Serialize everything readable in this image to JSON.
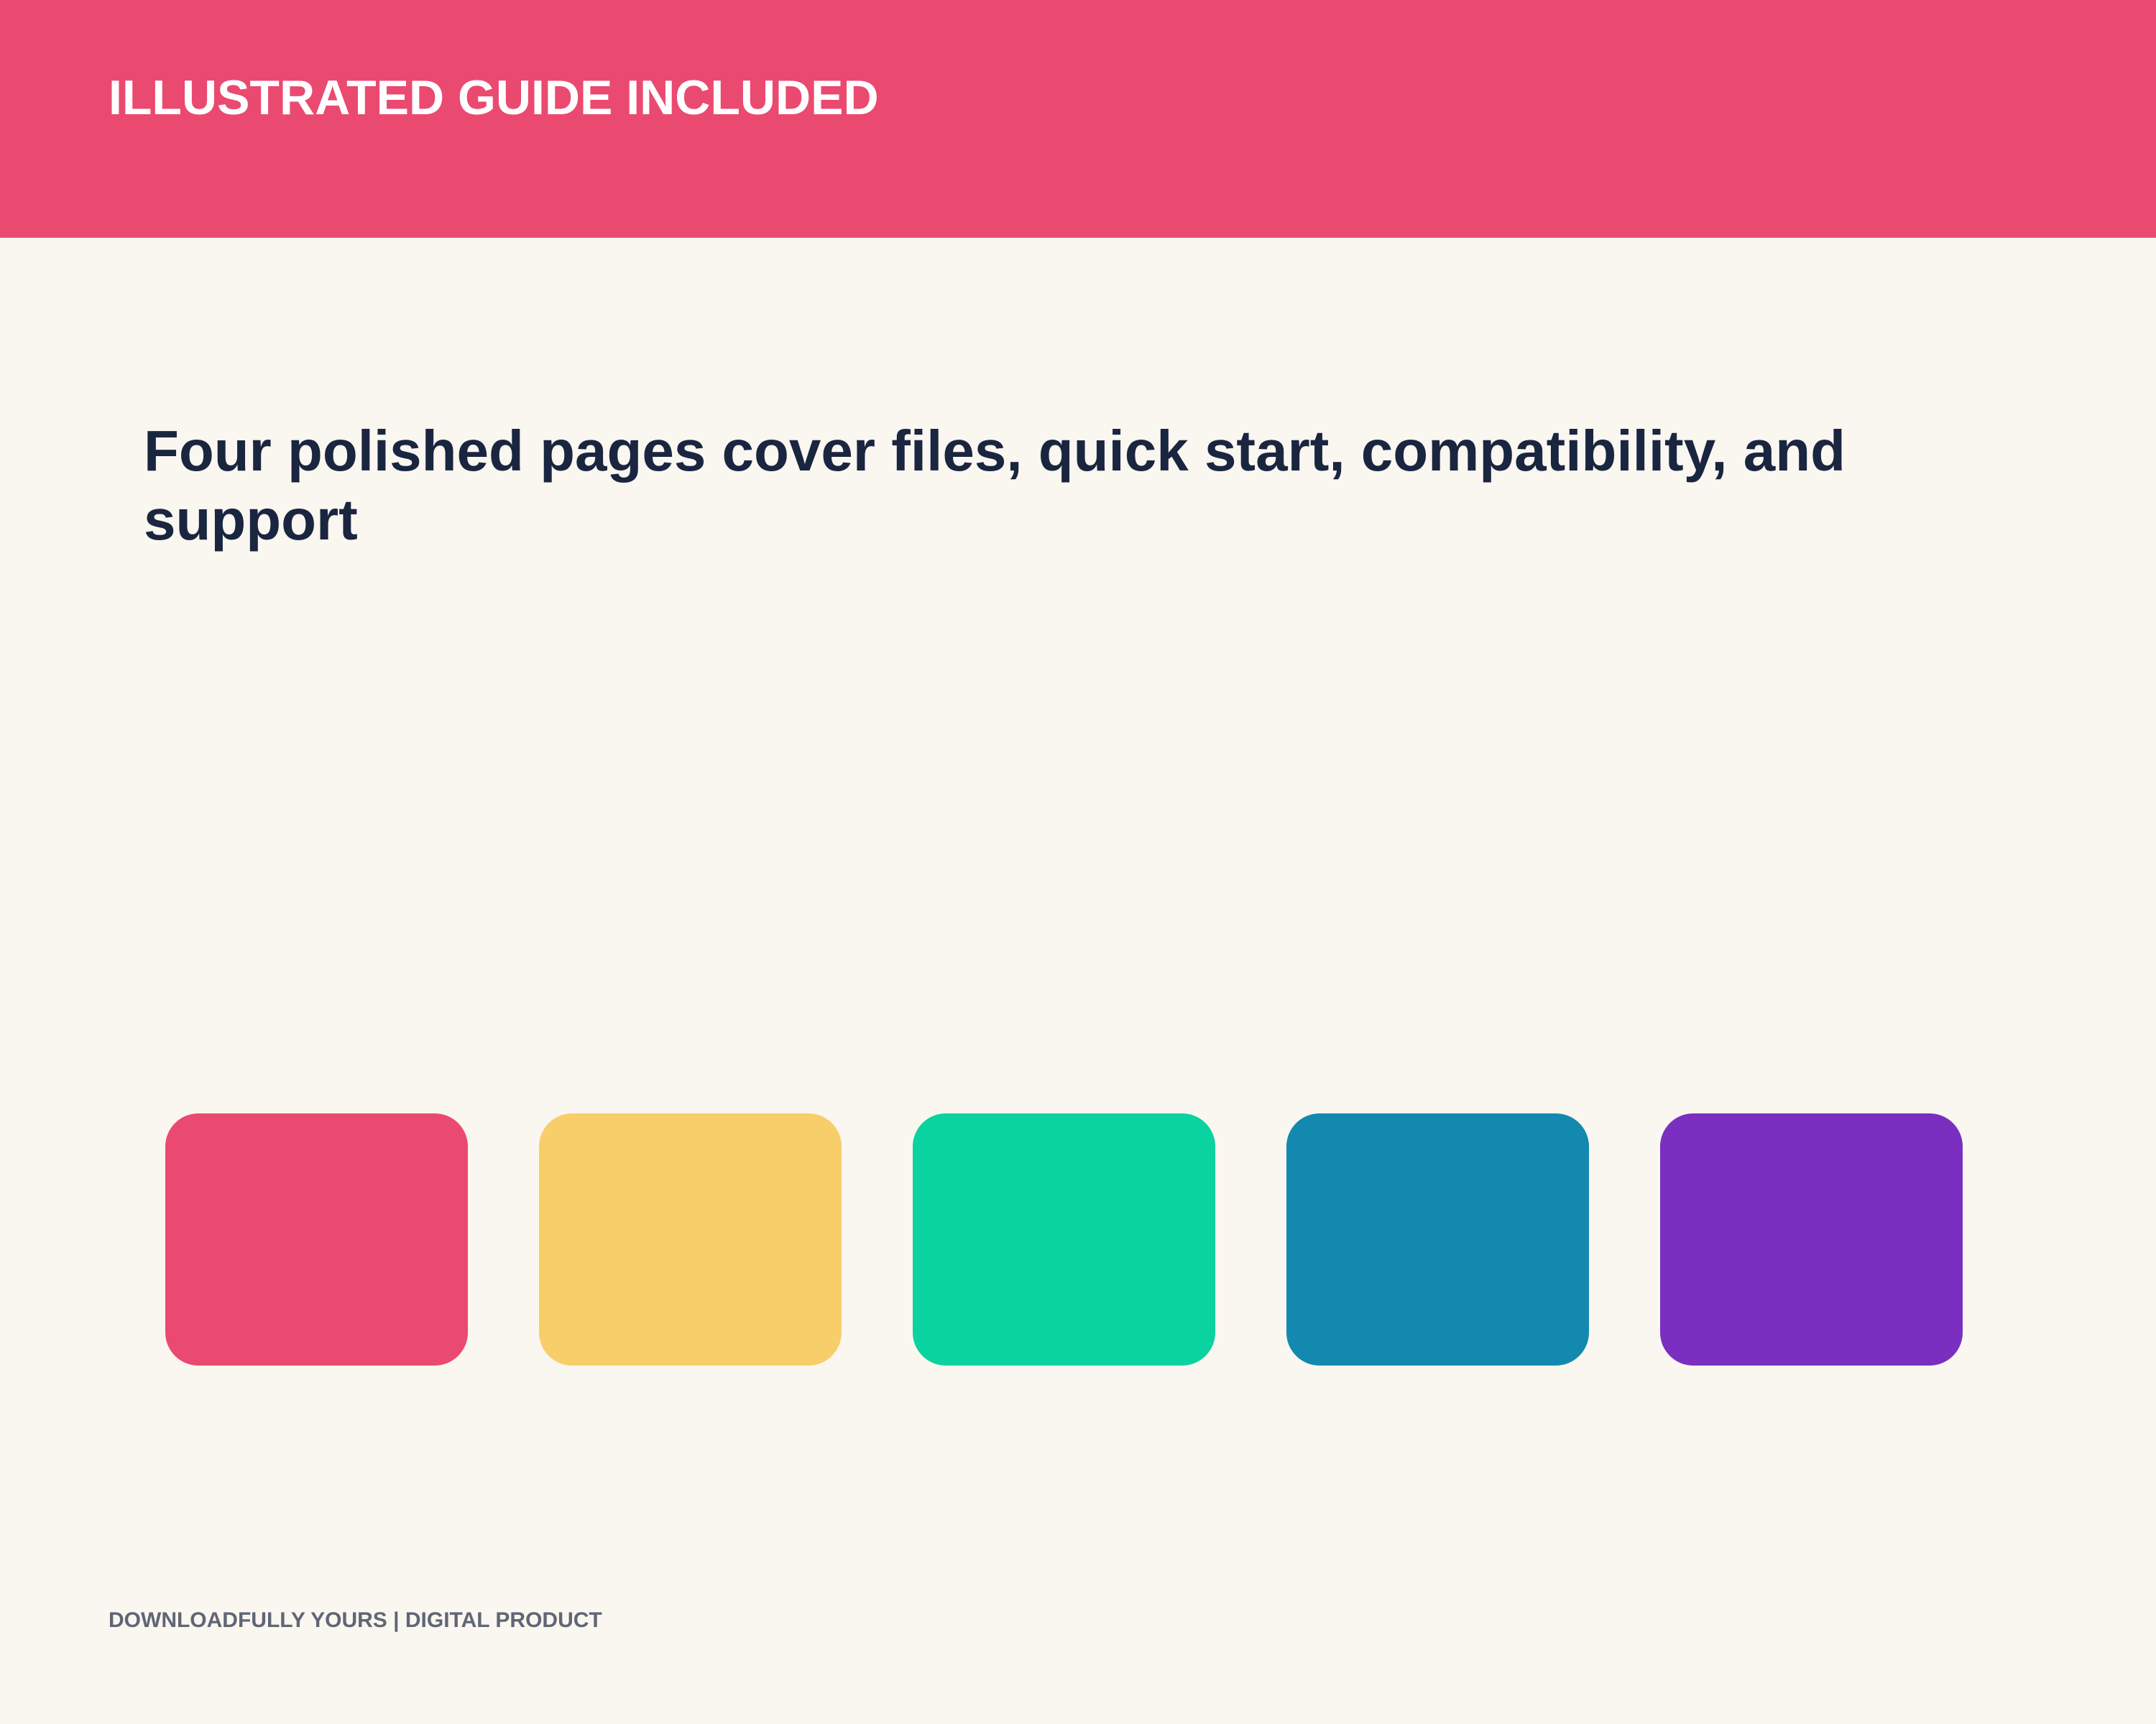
{
  "colors": {
    "background": "#faf6f0",
    "header_band": "#ea4a70",
    "headline_text": "#1a2540",
    "footer_text": "#5f6675"
  },
  "header": {
    "title": "ILLUSTRATED GUIDE INCLUDED"
  },
  "main": {
    "headline": "Four polished pages cover files, quick start, compatibility, and support"
  },
  "swatches": [
    {
      "color": "#ea4a70"
    },
    {
      "color": "#f8ce6a"
    },
    {
      "color": "#0bd3a0"
    },
    {
      "color": "#1489b0"
    },
    {
      "color": "#7b2fc0"
    }
  ],
  "footer": {
    "label": "DOWNLOADFULLY YOURS | DIGITAL PRODUCT"
  }
}
